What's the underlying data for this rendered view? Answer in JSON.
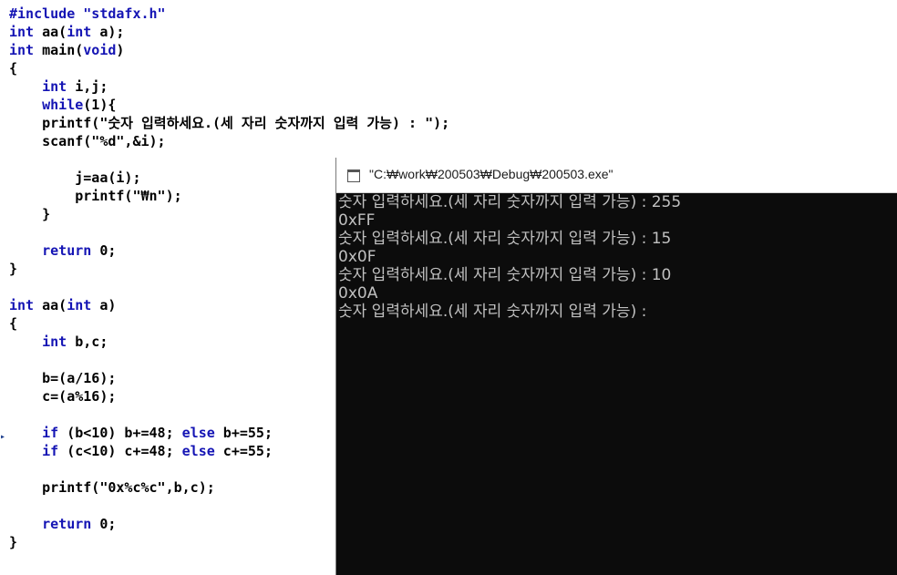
{
  "editor": {
    "lines": [
      [
        {
          "t": "#include \"stdafx.h\"",
          "k": true
        }
      ],
      [
        {
          "t": "int",
          "k": true
        },
        {
          "t": " aa("
        },
        {
          "t": "int",
          "k": true
        },
        {
          "t": " a);"
        }
      ],
      [
        {
          "t": "int",
          "k": true
        },
        {
          "t": " main("
        },
        {
          "t": "void",
          "k": true
        },
        {
          "t": ")"
        }
      ],
      [
        {
          "t": "{"
        }
      ],
      [
        {
          "t": "    "
        },
        {
          "t": "int",
          "k": true
        },
        {
          "t": " i,j;"
        }
      ],
      [
        {
          "t": "    "
        },
        {
          "t": "while",
          "k": true
        },
        {
          "t": "(1){"
        }
      ],
      [
        {
          "t": "    printf(\"숫자 입력하세요.(세 자리 숫자까지 입력 가능) : \");"
        }
      ],
      [
        {
          "t": "    scanf(\"%d\",&i);"
        }
      ],
      [
        {
          "t": ""
        }
      ],
      [
        {
          "t": "        j=aa(i);"
        }
      ],
      [
        {
          "t": "        printf(\"₩n\");"
        }
      ],
      [
        {
          "t": "    }"
        }
      ],
      [
        {
          "t": ""
        }
      ],
      [
        {
          "t": "    "
        },
        {
          "t": "return",
          "k": true
        },
        {
          "t": " 0;"
        }
      ],
      [
        {
          "t": "}"
        }
      ],
      [
        {
          "t": ""
        }
      ],
      [
        {
          "t": "int",
          "k": true
        },
        {
          "t": " aa("
        },
        {
          "t": "int",
          "k": true
        },
        {
          "t": " a)"
        }
      ],
      [
        {
          "t": "{"
        }
      ],
      [
        {
          "t": "    "
        },
        {
          "t": "int",
          "k": true
        },
        {
          "t": " b,c;"
        }
      ],
      [
        {
          "t": ""
        }
      ],
      [
        {
          "t": "    b=(a/16);"
        }
      ],
      [
        {
          "t": "    c=(a%16);"
        }
      ],
      [
        {
          "t": ""
        }
      ],
      [
        {
          "t": "    "
        },
        {
          "t": "if",
          "k": true
        },
        {
          "t": " (b<10) b+=48; "
        },
        {
          "t": "else",
          "k": true
        },
        {
          "t": " b+=55;"
        }
      ],
      [
        {
          "t": "    "
        },
        {
          "t": "if",
          "k": true
        },
        {
          "t": " (c<10) c+=48; "
        },
        {
          "t": "else",
          "k": true
        },
        {
          "t": " c+=55;"
        }
      ],
      [
        {
          "t": ""
        }
      ],
      [
        {
          "t": "    printf(\"0x%c%c\",b,c);"
        }
      ],
      [
        {
          "t": ""
        }
      ],
      [
        {
          "t": "    "
        },
        {
          "t": "return",
          "k": true
        },
        {
          "t": " 0;"
        }
      ],
      [
        {
          "t": "}"
        }
      ]
    ],
    "keyword_color": "#1414b4",
    "text_color": "#000000",
    "gutter_marker": "▸"
  },
  "console": {
    "title": "\"C:₩work₩200503₩Debug₩200503.exe\"",
    "icon": "console-window-icon",
    "background": "#0c0c0c",
    "text_color": "#c0c0c0",
    "lines": [
      "숫자 입력하세요.(세 자리 숫자까지 입력 가능) : 255",
      "0xFF",
      "숫자 입력하세요.(세 자리 숫자까지 입력 가능) : 15",
      "0x0F",
      "숫자 입력하세요.(세 자리 숫자까지 입력 가능) : 10",
      "0x0A",
      "숫자 입력하세요.(세 자리 숫자까지 입력 가능) :"
    ]
  }
}
